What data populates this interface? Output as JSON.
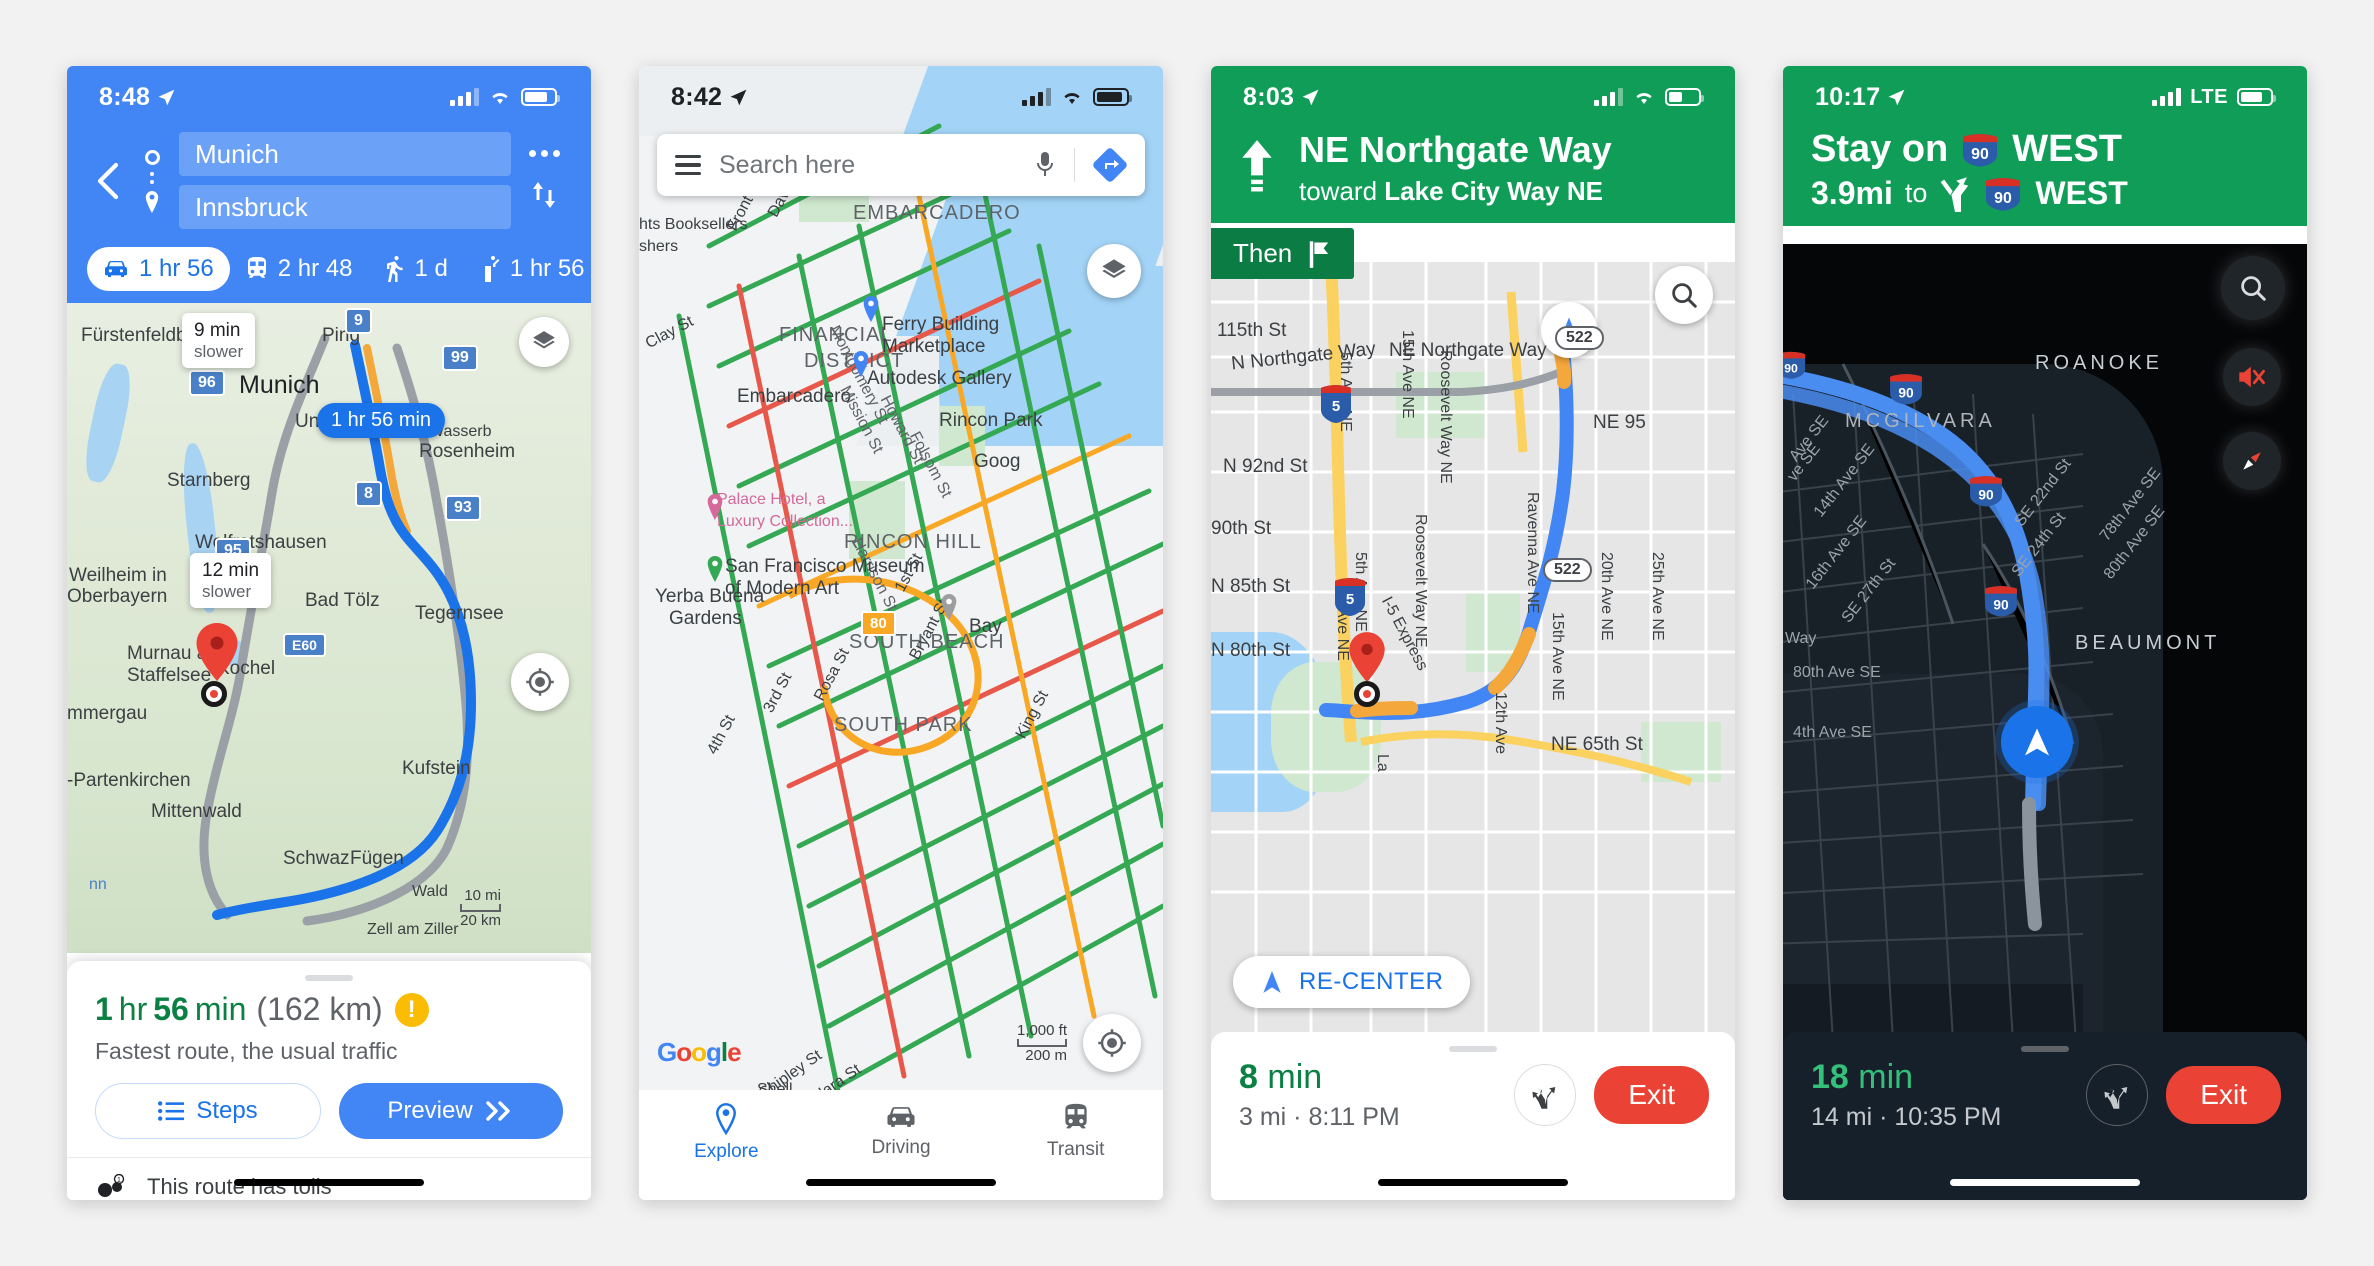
{
  "panels": [
    {
      "id": "directions-overview",
      "status": {
        "time": "8:48",
        "carrier_icon": "signal-bars-icon",
        "wifi": "wifi-icon",
        "battery": "battery-icon"
      },
      "header": {
        "back_icon": "back-chevron-icon",
        "origin": "Munich",
        "destination": "Innsbruck",
        "more_icon": "more-options-icon",
        "swap_icon": "swap-endpoints-icon",
        "modes": [
          {
            "icon": "car-icon",
            "label": "1 hr 56",
            "selected": true
          },
          {
            "icon": "transit-icon",
            "label": "2 hr 48",
            "selected": false
          },
          {
            "icon": "walking-icon",
            "label": "1 d",
            "selected": false
          },
          {
            "icon": "rideshare-icon",
            "label": "1 hr 56",
            "selected": false
          },
          {
            "icon": "cycling-icon",
            "label": "",
            "selected": false
          }
        ]
      },
      "map": {
        "labels": [
          "Fürstenfeldb",
          "Poing",
          "Munich",
          "Unterhaching",
          "Starnberg",
          "Wolfratshausen",
          "Weilheim in",
          "Oberbayern",
          "Bad Tölz",
          "Tegernsee",
          "Rosenheim",
          "Murnau am",
          "Staffelsee",
          "Kochel",
          "mmergau",
          "-Partenkirchen",
          "Mittenwald",
          "Kufstein",
          "Schwaz",
          "Fügen",
          "Wald",
          "Zell am Ziller",
          "Wasserb",
          "nn",
          "Ping"
        ],
        "shields": [
          "9",
          "99",
          "96",
          "95",
          "8",
          "93",
          "E60"
        ],
        "callouts": [
          {
            "time": "9 min",
            "note": "slower"
          },
          {
            "time": "12 min",
            "note": "slower"
          }
        ],
        "eta_pill": "1 hr 56 min",
        "scale": {
          "imperial": "10 mi",
          "metric": "20 km"
        },
        "layers_icon": "map-layers-icon",
        "locate_icon": "my-location-icon"
      },
      "sheet": {
        "duration_num": "1",
        "duration_unit": "hr",
        "duration_num2": "56",
        "duration_unit2": "min",
        "distance": "(162 km)",
        "warning_icon": "warning-badge-icon",
        "subtitle": "Fastest route, the usual traffic",
        "steps_label": "Steps",
        "steps_icon": "list-icon",
        "preview_label": "Preview",
        "preview_icon": "double-chevron-icon",
        "tolls_text": "This route has tolls",
        "tolls_icon": "toll-icon"
      }
    },
    {
      "id": "explore-traffic",
      "status": {
        "time": "8:42"
      },
      "search": {
        "menu_icon": "hamburger-menu-icon",
        "placeholder": "Search here",
        "mic_icon": "microphone-icon",
        "directions_icon": "directions-icon"
      },
      "map": {
        "labels": [
          "EMBARCADERO",
          "FINANCIAL",
          "DISTRICT",
          "Ferry Building",
          "Marketplace",
          "Autodesk Gallery",
          "Embarcadero",
          "Rincon Park",
          "Montgomery St",
          "Mission St",
          "Howard St",
          "Folsom St",
          "Harrison St",
          "RINCON HILL",
          "SOUTH BEACH",
          "SOUTH PARK",
          "Yerba Buena",
          "Gardens",
          "San Francisco Museum",
          "of Modern Art",
          "Palace Hotel, a",
          "Luxury Collection...",
          "hts Booksellers",
          "shers",
          "Clay St",
          "Davis St",
          "Front St",
          "3rd St",
          "4th St",
          "Rosa St",
          "1st St",
          "Bay",
          "Goog",
          "King St",
          "Shell",
          "Clara St",
          "Shipley St",
          "Bryant St",
          "80"
        ],
        "scale": {
          "imperial": "1,000 ft",
          "metric": "200 m"
        },
        "layers_icon": "map-layers-icon",
        "locate_icon": "my-location-icon",
        "logo": "Google"
      },
      "bottomnav": [
        {
          "icon": "place-pin-icon",
          "label": "Explore",
          "active": true
        },
        {
          "icon": "car-icon",
          "label": "Driving",
          "active": false
        },
        {
          "icon": "transit-icon",
          "label": "Transit",
          "active": false
        }
      ]
    },
    {
      "id": "navigation-light",
      "status": {
        "time": "8:03"
      },
      "header": {
        "maneuver_icon": "straight-arrow-icon",
        "street": "NE Northgate Way",
        "toward_prefix": "toward",
        "toward": "Lake City Way NE",
        "then_label": "Then",
        "then_icon": "turn-right-flag-icon"
      },
      "map": {
        "labels": [
          "115th St",
          "N Northgate Way",
          "NE Northgate Way",
          "5th Ave NE",
          "15th Ave NE",
          "Roosevelt Way NE",
          "NE 95",
          "N 92nd St",
          "90th St",
          "N 85th St",
          "N 80th St",
          "5th Ave NE",
          "Roosevelt Way NE",
          "Ravenna Ave NE",
          "20th Ave NE",
          "25th Ave NE",
          "15th Ave NE",
          "12th Ave",
          "NE 65th St",
          "I-5 Express",
          "1st Ave NE",
          "La"
        ],
        "shields": [
          "5",
          "5",
          "522",
          "522"
        ],
        "recenter_label": "RE-CENTER",
        "recenter_icon": "navigation-arrow-icon",
        "search_icon": "search-icon"
      },
      "sheet": {
        "eta_num": "8",
        "eta_unit": "min",
        "detail": "3 mi · 8:11 PM",
        "route_alt_icon": "alternate-routes-icon",
        "exit_label": "Exit"
      }
    },
    {
      "id": "navigation-dark",
      "status": {
        "time": "10:17",
        "network": "LTE"
      },
      "header": {
        "line1_prefix": "Stay on",
        "line1_shield": "90",
        "line1_suffix": "WEST",
        "line2_distance": "3.9mi",
        "line2_to": "to",
        "line2_icon": "keep-left-icon",
        "line2_shield": "90",
        "line2_suffix": "WEST"
      },
      "map": {
        "labels": [
          "ROANOKE",
          "MCGILVARA",
          "BEAUMONT",
          "14th Ave SE",
          "16th Ave SE",
          "SE 27th St",
          "SE 22nd St",
          "SE 24th St",
          "78th Ave SE",
          "80th Ave SE",
          "80th Ave SE",
          "4th Ave SE",
          "Way",
          "Ave SE",
          "ve SE"
        ],
        "shields": [
          "90",
          "90",
          "90",
          "90"
        ],
        "search_icon": "search-icon",
        "mute_icon": "volume-muted-icon",
        "compass_icon": "compass-icon"
      },
      "sheet": {
        "eta_num": "18",
        "eta_unit": "min",
        "detail": "14 mi · 10:35 PM",
        "route_alt_icon": "alternate-routes-icon",
        "exit_label": "Exit"
      }
    }
  ],
  "colors": {
    "blue": "#4285f4",
    "green_header": "#109d58",
    "green_dark": "#0b7c44",
    "red_exit": "#ea4335",
    "eta_green": "#0b8043",
    "warn_yellow": "#fbbc04"
  }
}
